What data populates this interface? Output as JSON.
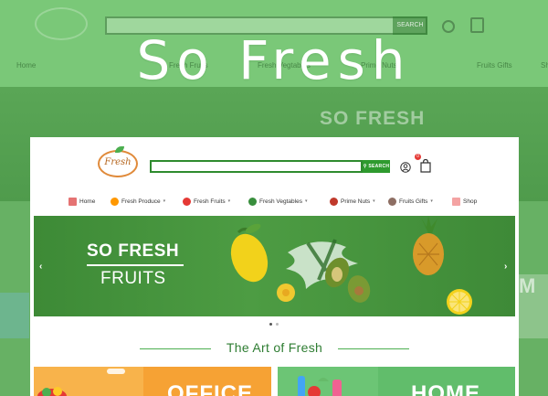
{
  "headline": "So Fresh",
  "background": {
    "search_button": "SEARCH",
    "big_text": "SO FRESH",
    "side_text": "M",
    "nav": [
      "Home",
      "Fresh Fruits",
      "Fresh Vegtables",
      "Prime Nuts",
      "Fruits Gifts",
      "Shop"
    ]
  },
  "site": {
    "logo_text": "Fresh",
    "search": {
      "placeholder": "",
      "button_label": "SEARCH"
    },
    "cart_count": "0",
    "nav": [
      {
        "label": "Home",
        "icon": "home-icon",
        "has_menu": false,
        "color": "#e57373"
      },
      {
        "label": "Fresh Produce",
        "icon": "orange-icon",
        "has_menu": true,
        "color": "#ff9800"
      },
      {
        "label": "Fresh Fruits",
        "icon": "apple-icon",
        "has_menu": true,
        "color": "#e53935"
      },
      {
        "label": "Fresh Vegtables",
        "icon": "broccoli-icon",
        "has_menu": true,
        "color": "#388e3c"
      },
      {
        "label": "Prime Nuts",
        "icon": "nuts-icon",
        "has_menu": true,
        "color": "#c0392b"
      },
      {
        "label": "Fruits Gifts",
        "icon": "basket-icon",
        "has_menu": true,
        "color": "#8d6e63"
      },
      {
        "label": "Shop",
        "icon": "shop-icon",
        "has_menu": false,
        "color": "#f4a3a3"
      }
    ],
    "banner": {
      "title": "SO FRESH",
      "subtitle": "FRUITS",
      "slide_count": 2,
      "active_slide": 1
    },
    "section_title": "The Art of Fresh",
    "tiles": [
      {
        "caption": "OFFICE",
        "color": "#f6a234"
      },
      {
        "caption": "HOME",
        "color": "#61bd6b"
      }
    ]
  },
  "colors": {
    "accent_green": "#2e9a2e",
    "backdrop_green": "#5fae5c",
    "badge_red": "#e53935"
  }
}
